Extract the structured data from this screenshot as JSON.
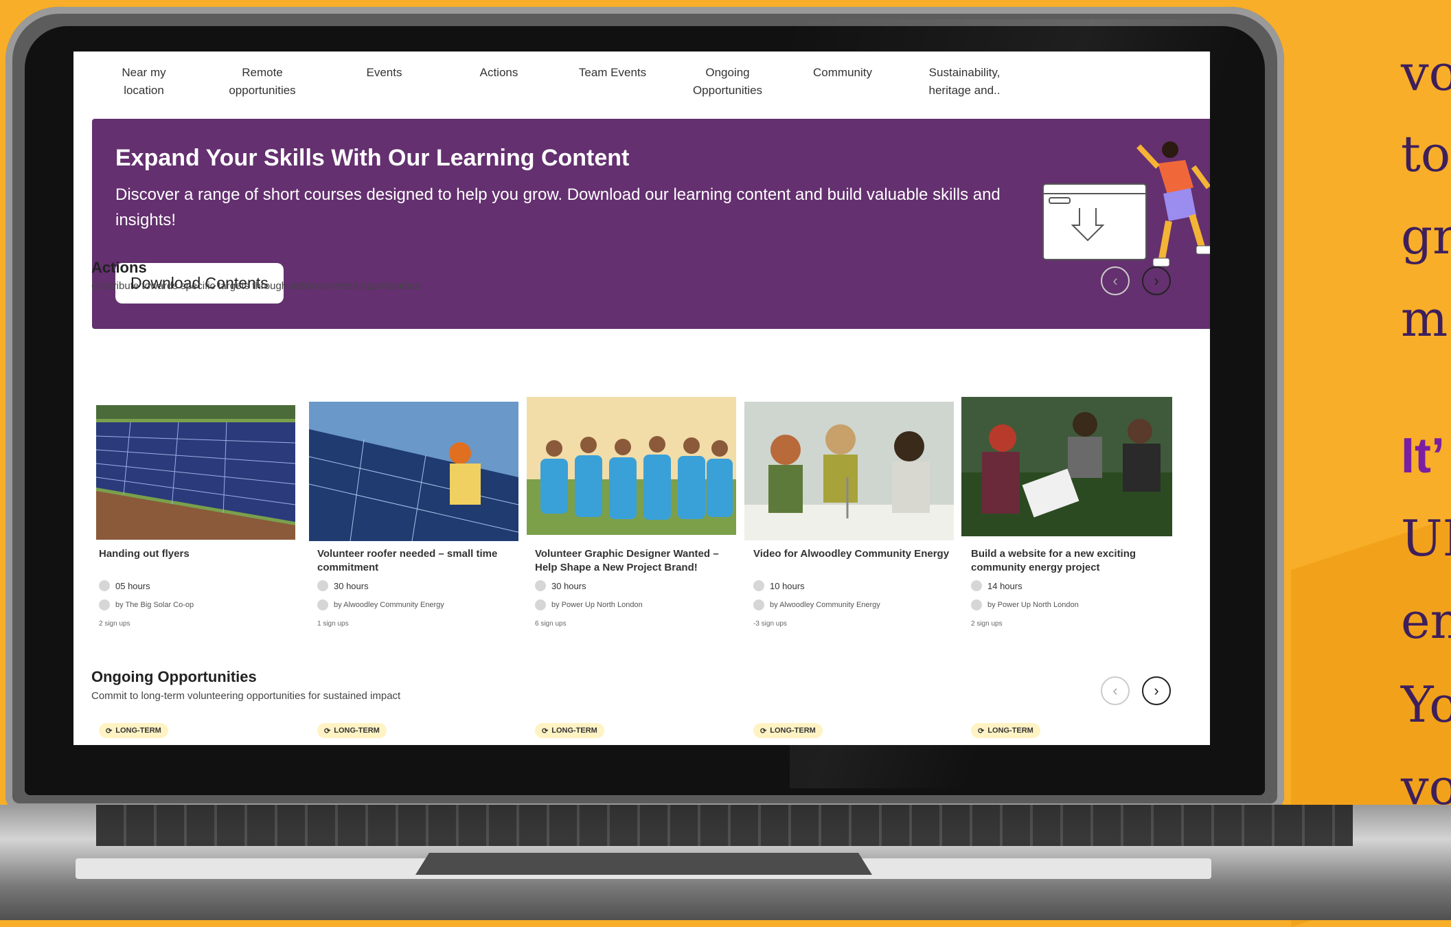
{
  "nav": {
    "items": [
      {
        "line1": "Near my",
        "line2": "location"
      },
      {
        "line1": "Remote",
        "line2": "opportunities"
      },
      {
        "line1": "Events",
        "line2": ""
      },
      {
        "line1": "Actions",
        "line2": ""
      },
      {
        "line1": "Team Events",
        "line2": ""
      },
      {
        "line1": "Ongoing",
        "line2": "Opportunities"
      },
      {
        "line1": "Community",
        "line2": ""
      },
      {
        "line1": "Sustainability,",
        "line2": "heritage and.."
      }
    ]
  },
  "banner": {
    "title": "Expand Your Skills With Our Learning Content",
    "description": "Discover a range of short courses designed to help you grow. Download our learning content and build valuable skills and insights!",
    "button_label": "Download Contents",
    "color": "#64306F"
  },
  "actions": {
    "title": "Actions",
    "subtitle": "Contribute towards specific targets through action-oriented opportunities",
    "cards": [
      {
        "title": "Handing out flyers",
        "hours": "05 hours",
        "org": "by The Big Solar Co-op",
        "signups": "2 sign ups",
        "image": "solar-panels-field"
      },
      {
        "title": "Volunteer roofer needed – small time commitment",
        "hours": "30 hours",
        "org": "by Alwoodley Community Energy",
        "signups": "1 sign ups",
        "image": "solar-roofer"
      },
      {
        "title": "Volunteer Graphic Designer Wanted – Help Shape a New Project Brand!",
        "hours": "30 hours",
        "org": "by Power Up North London",
        "signups": "6 sign ups",
        "image": "volunteer-group"
      },
      {
        "title": "Video for Alwoodley Community Energy",
        "hours": "10 hours",
        "org": "by Alwoodley Community Energy",
        "signups": "-3 sign ups",
        "image": "kids-wind-turbines"
      },
      {
        "title": "Build a website for a new exciting community energy project",
        "hours": "14 hours",
        "org": "by Power Up North London",
        "signups": "2 sign ups",
        "image": "community-garden"
      }
    ]
  },
  "ongoing": {
    "title": "Ongoing Opportunities",
    "subtitle": "Commit to long-term volunteering opportunities for sustained impact",
    "tags": [
      "LONG-TERM",
      "LONG-TERM",
      "LONG-TERM",
      "LONG-TERM",
      "LONG-TERM"
    ]
  },
  "side_text": {
    "lines": [
      "vo",
      "to",
      "gr",
      "m",
      "It’",
      "UI",
      "en",
      "Yo",
      "vo"
    ]
  },
  "colors": {
    "background": "#F8AE28",
    "banner": "#64306F",
    "side_text": "#3E1F5C",
    "tag_bg": "#FFF3C4"
  }
}
